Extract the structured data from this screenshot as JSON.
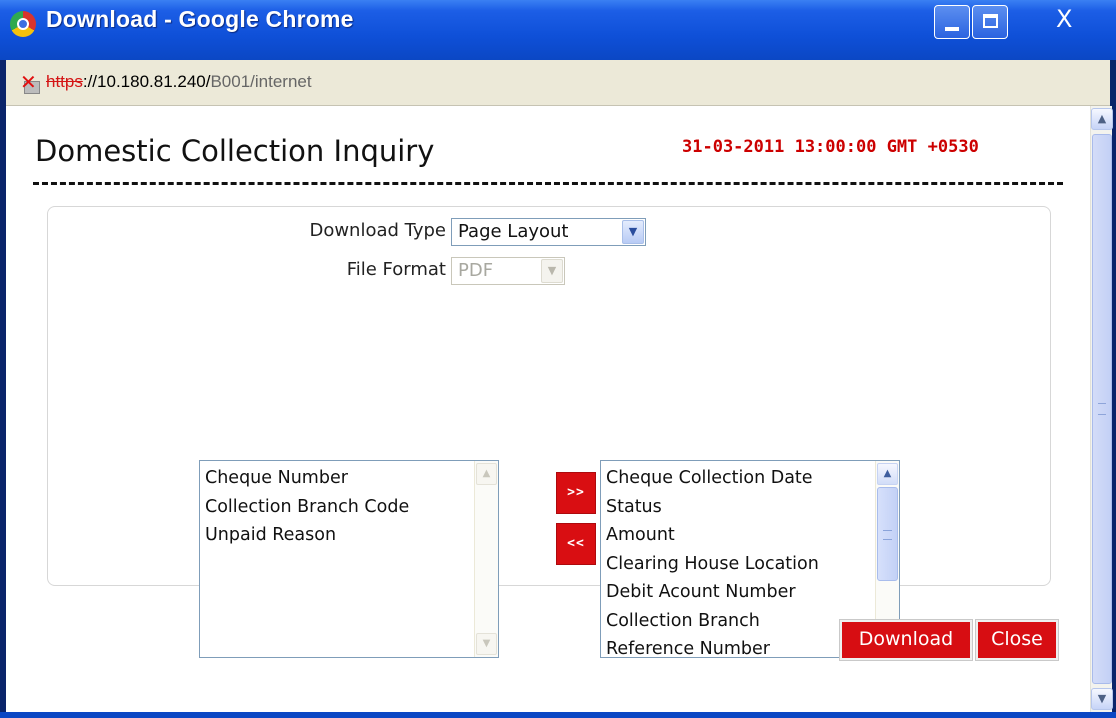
{
  "window": {
    "title": "Download - Google Chrome",
    "close_glyph": "X"
  },
  "addressbar": {
    "url_scheme": "https",
    "url_host": "://10.180.81.240/",
    "url_path": "B001/internet"
  },
  "page": {
    "title": "Domestic Collection Inquiry",
    "timestamp": "31-03-2011 13:00:00 GMT +0530"
  },
  "form": {
    "download_type_label": "Download Type",
    "download_type_value": "Page Layout",
    "file_format_label": "File Format",
    "file_format_value": "PDF"
  },
  "available_columns": {
    "items": [
      "Cheque Number",
      "Collection Branch Code",
      "Unpaid Reason"
    ]
  },
  "selected_columns": {
    "items": [
      "Cheque Collection Date",
      "Status",
      "Amount",
      "Clearing House Location",
      "Debit Acount Number",
      "Collection Branch",
      "Reference Number"
    ]
  },
  "transfer": {
    "add_label": ">>",
    "remove_label": "<<"
  },
  "actions": {
    "download_label": "Download",
    "close_label": "Close"
  },
  "colors": {
    "accent_red": "#d70d12",
    "timestamp_red": "#cc0000",
    "titlebar_blue": "#0f50d8"
  },
  "icons": {
    "app": "chrome-logo-icon",
    "security": "broken-lock-icon",
    "dropdown": "chevron-down-icon"
  }
}
